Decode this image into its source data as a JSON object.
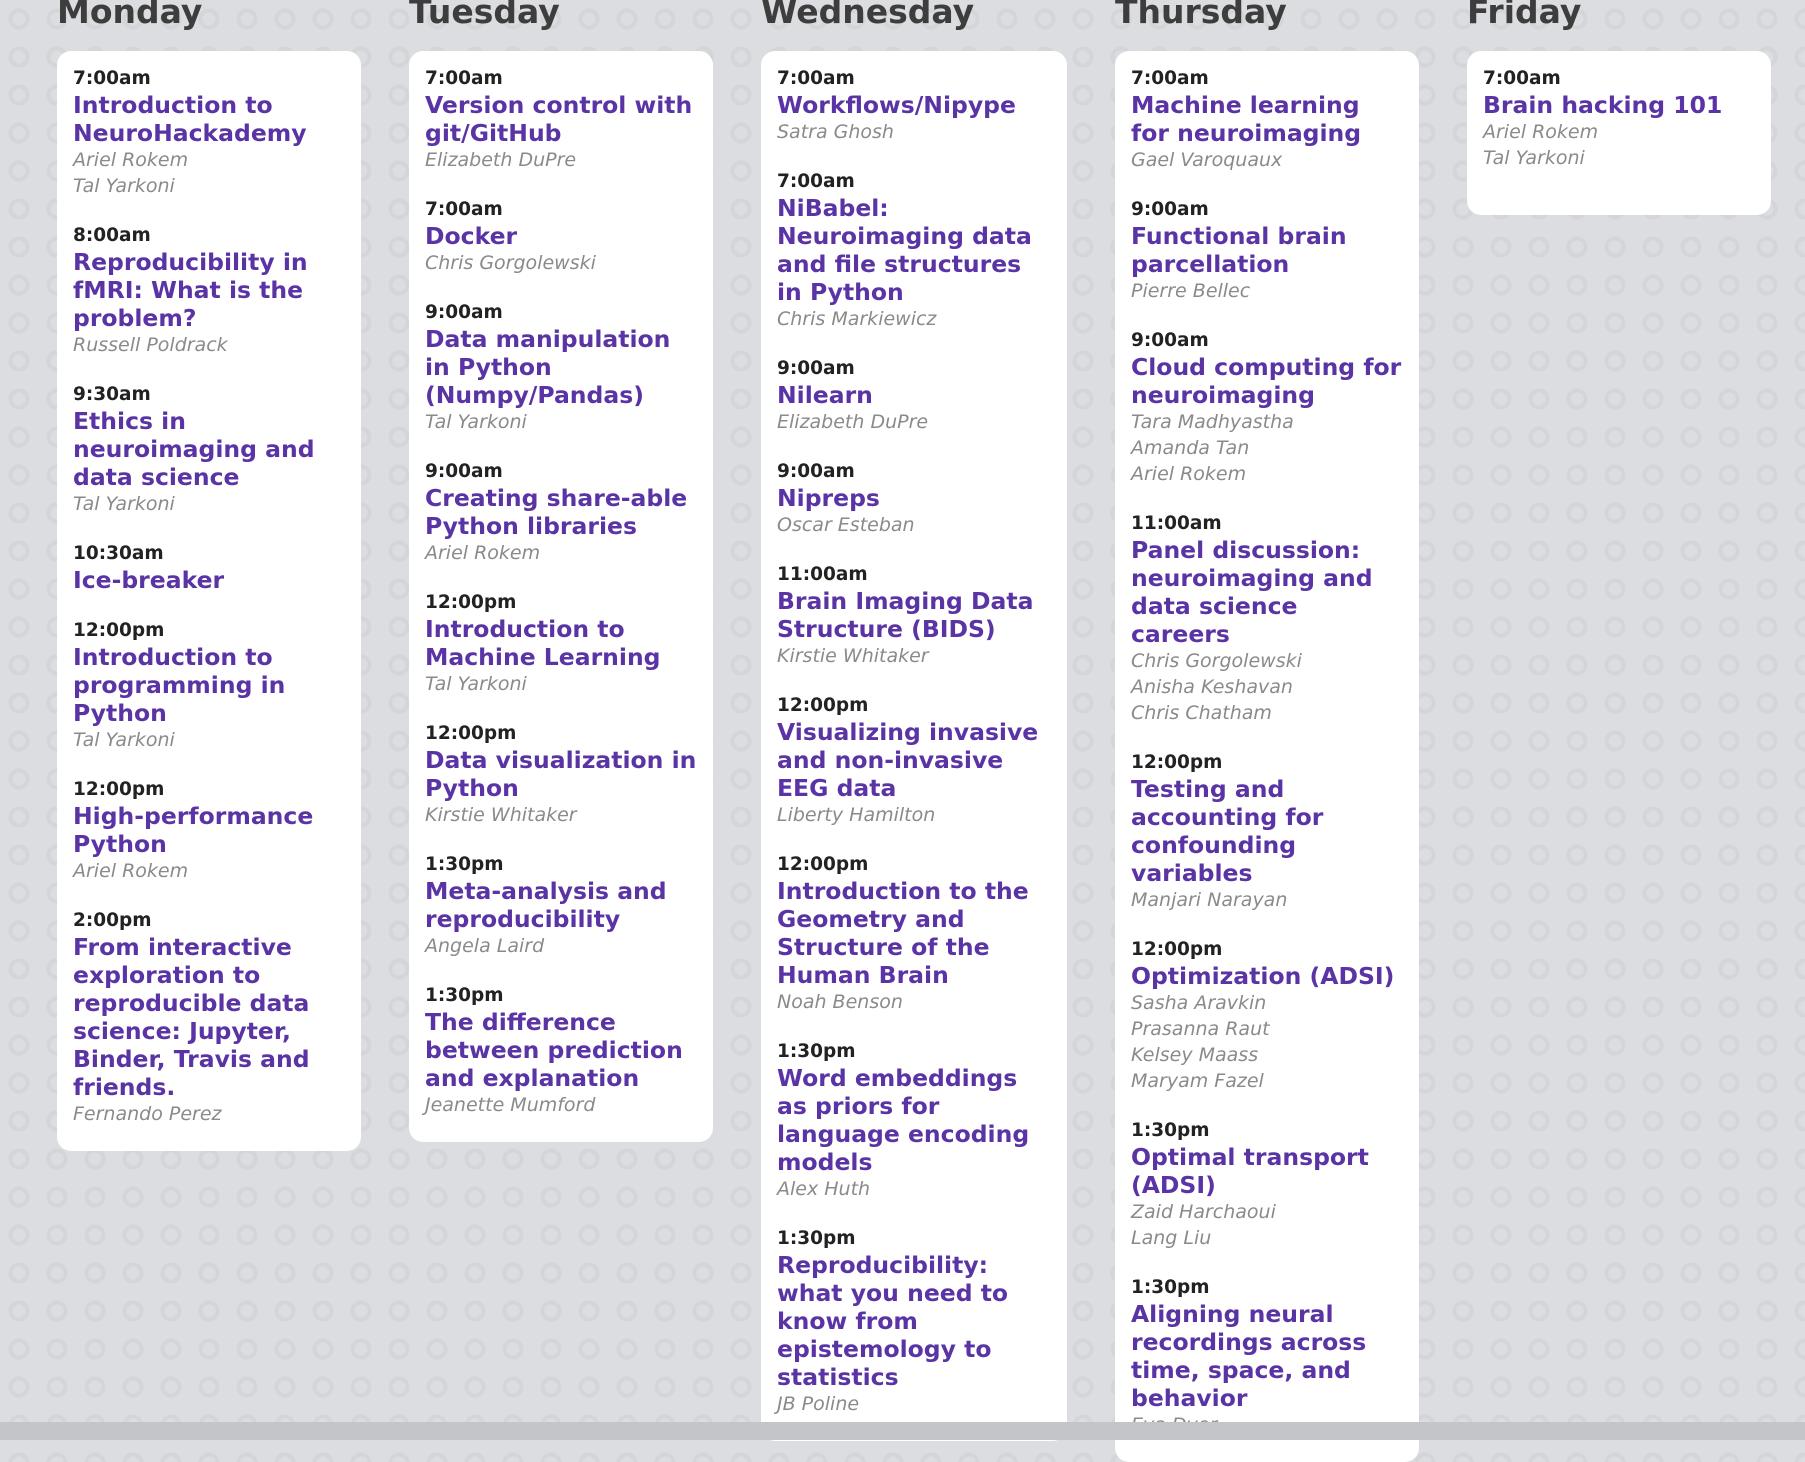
{
  "days": [
    {
      "name": "Monday",
      "events": [
        {
          "time": "7:00am",
          "title": "Introduction to NeuroHackademy",
          "speakers": [
            "Ariel Rokem",
            "Tal Yarkoni"
          ]
        },
        {
          "time": "8:00am",
          "title": "Reproducibility in fMRI: What is the problem?",
          "speakers": [
            "Russell Poldrack"
          ]
        },
        {
          "time": "9:30am",
          "title": "Ethics in neuroimaging and data science",
          "speakers": [
            "Tal Yarkoni"
          ]
        },
        {
          "time": "10:30am",
          "title": "Ice-breaker",
          "speakers": []
        },
        {
          "time": "12:00pm",
          "title": "Introduction to programming in Python",
          "speakers": [
            "Tal Yarkoni"
          ]
        },
        {
          "time": "12:00pm",
          "title": "High-performance Python",
          "speakers": [
            "Ariel Rokem"
          ]
        },
        {
          "time": "2:00pm",
          "title": "From interactive exploration to reproducible data science: Jupyter, Binder, Travis and friends.",
          "speakers": [
            "Fernando Perez"
          ]
        }
      ]
    },
    {
      "name": "Tuesday",
      "events": [
        {
          "time": "7:00am",
          "title": "Version control with git/GitHub",
          "speakers": [
            "Elizabeth DuPre"
          ]
        },
        {
          "time": "7:00am",
          "title": "Docker",
          "speakers": [
            "Chris Gorgolewski"
          ]
        },
        {
          "time": "9:00am",
          "title": "Data manipulation in Python (Numpy/Pandas)",
          "speakers": [
            "Tal Yarkoni"
          ]
        },
        {
          "time": "9:00am",
          "title": "Creating share-able Python libraries",
          "speakers": [
            "Ariel Rokem"
          ]
        },
        {
          "time": "12:00pm",
          "title": "Introduction to Machine Learning",
          "speakers": [
            "Tal Yarkoni"
          ]
        },
        {
          "time": "12:00pm",
          "title": "Data visualization in Python",
          "speakers": [
            "Kirstie Whitaker"
          ]
        },
        {
          "time": "1:30pm",
          "title": "Meta-analysis and reproducibility",
          "speakers": [
            "Angela Laird"
          ]
        },
        {
          "time": "1:30pm",
          "title": "The difference between prediction and explanation",
          "speakers": [
            "Jeanette Mumford"
          ]
        }
      ]
    },
    {
      "name": "Wednesday",
      "events": [
        {
          "time": "7:00am",
          "title": "Workflows/Nipype",
          "speakers": [
            "Satra Ghosh"
          ]
        },
        {
          "time": "7:00am",
          "title": "NiBabel: Neuroimaging data and file structures in Python",
          "speakers": [
            "Chris Markiewicz"
          ]
        },
        {
          "time": "9:00am",
          "title": "Nilearn",
          "speakers": [
            "Elizabeth DuPre"
          ]
        },
        {
          "time": "9:00am",
          "title": "Nipreps",
          "speakers": [
            "Oscar Esteban"
          ]
        },
        {
          "time": "11:00am",
          "title": "Brain Imaging Data Structure (BIDS)",
          "speakers": [
            "Kirstie Whitaker"
          ]
        },
        {
          "time": "12:00pm",
          "title": "Visualizing invasive and non-invasive EEG data",
          "speakers": [
            "Liberty Hamilton"
          ]
        },
        {
          "time": "12:00pm",
          "title": "Introduction to the Geometry and Structure of the Human Brain",
          "speakers": [
            "Noah Benson"
          ]
        },
        {
          "time": "1:30pm",
          "title": "Word embeddings as priors for language encoding models",
          "speakers": [
            "Alex Huth"
          ]
        },
        {
          "time": "1:30pm",
          "title": "Reproducibility: what you need to know from epistemology to statistics",
          "speakers": [
            "JB Poline"
          ]
        }
      ]
    },
    {
      "name": "Thursday",
      "events": [
        {
          "time": "7:00am",
          "title": "Machine learning for neuroimaging",
          "speakers": [
            "Gael Varoquaux"
          ]
        },
        {
          "time": "9:00am",
          "title": "Functional brain parcellation",
          "speakers": [
            "Pierre Bellec"
          ]
        },
        {
          "time": "9:00am",
          "title": "Cloud computing for neuroimaging",
          "speakers": [
            "Tara Madhyastha",
            "Amanda Tan",
            "Ariel Rokem"
          ]
        },
        {
          "time": "11:00am",
          "title": "Panel discussion: neuroimaging and data science careers",
          "speakers": [
            "Chris Gorgolewski",
            "Anisha Keshavan",
            "Chris Chatham"
          ]
        },
        {
          "time": "12:00pm",
          "title": "Testing and accounting for confounding variables",
          "speakers": [
            "Manjari Narayan"
          ]
        },
        {
          "time": "12:00pm",
          "title": "Optimization (ADSI)",
          "speakers": [
            "Sasha Aravkin",
            "Prasanna Raut",
            "Kelsey Maass",
            "Maryam Fazel"
          ]
        },
        {
          "time": "1:30pm",
          "title": "Optimal transport (ADSI)",
          "speakers": [
            "Zaid Harchaoui",
            "Lang Liu"
          ]
        },
        {
          "time": "1:30pm",
          "title": "Aligning neural recordings across time, space, and behavior",
          "speakers": [
            "Eva Dyer"
          ]
        }
      ]
    },
    {
      "name": "Friday",
      "events": [
        {
          "time": "7:00am",
          "title": "Brain hacking 101",
          "speakers": [
            "Ariel Rokem",
            "Tal Yarkoni"
          ]
        }
      ]
    }
  ],
  "colors": {
    "title": "#5a34a5",
    "time": "#222222",
    "speaker": "#8a8a8a",
    "day_heading": "#3d3d3d"
  }
}
